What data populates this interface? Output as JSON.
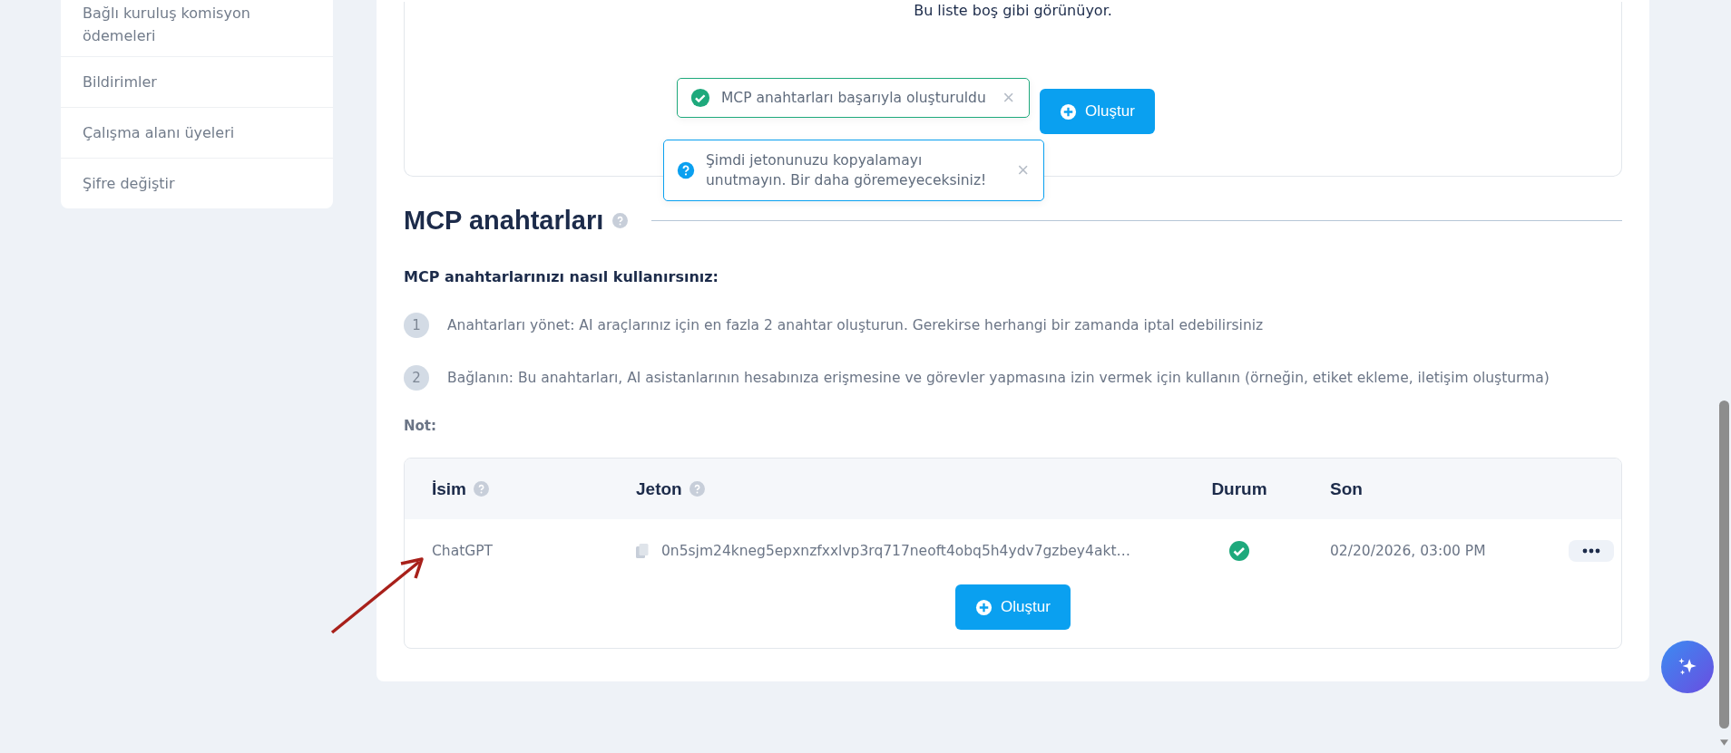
{
  "sidebar": {
    "items": [
      {
        "label": "Bağlı kuruluş komisyon ödemeleri",
        "selected": false
      },
      {
        "label": "Bildirimler",
        "selected": false
      },
      {
        "label": "Çalışma alanı üyeleri",
        "selected": false
      },
      {
        "label": "Şifre değiştir",
        "selected": false
      }
    ]
  },
  "empty_state": {
    "message": "Bu liste boş gibi görünüyor.",
    "button": "Oluştur"
  },
  "toasts": [
    {
      "kind": "success",
      "message": "MCP anahtarları başarıyla oluşturuldu",
      "close": "×"
    },
    {
      "kind": "info",
      "message": "Şimdi jetonunuzu kopyalamayı unutmayın. Bir daha göremeyeceksiniz!",
      "close": "×"
    }
  ],
  "section": {
    "title": "MCP anahtarları",
    "subtitle": "MCP anahtarlarınızı nasıl kullanırsınız:",
    "steps": [
      {
        "number": "1",
        "text": "Anahtarları yönet: AI araçlarınız için en fazla 2 anahtar oluşturun. Gerekirse herhangi bir zamanda iptal edebilirsiniz"
      },
      {
        "number": "2",
        "text": "Bağlanın: Bu anahtarları, AI asistanlarının hesabınıza erişmesine ve görevler yapmasına izin vermek için kullanın (örneğin, etiket ekleme, iletişim oluşturma)"
      }
    ],
    "note": "Not:"
  },
  "table": {
    "columns": [
      {
        "label": "İsim",
        "help": true
      },
      {
        "label": "Jeton",
        "help": true
      },
      {
        "label": "Durum",
        "help": false
      },
      {
        "label": "Son",
        "help": false
      }
    ],
    "rows": [
      {
        "name": "ChatGPT",
        "token": "0n5sjm24kneg5epxnzfxxlvp3rq717neoft4obq5h4ydv7gzbey4akt…",
        "active": true,
        "last": "02/20/2026, 03:00 PM"
      }
    ],
    "button": "Oluştur"
  }
}
